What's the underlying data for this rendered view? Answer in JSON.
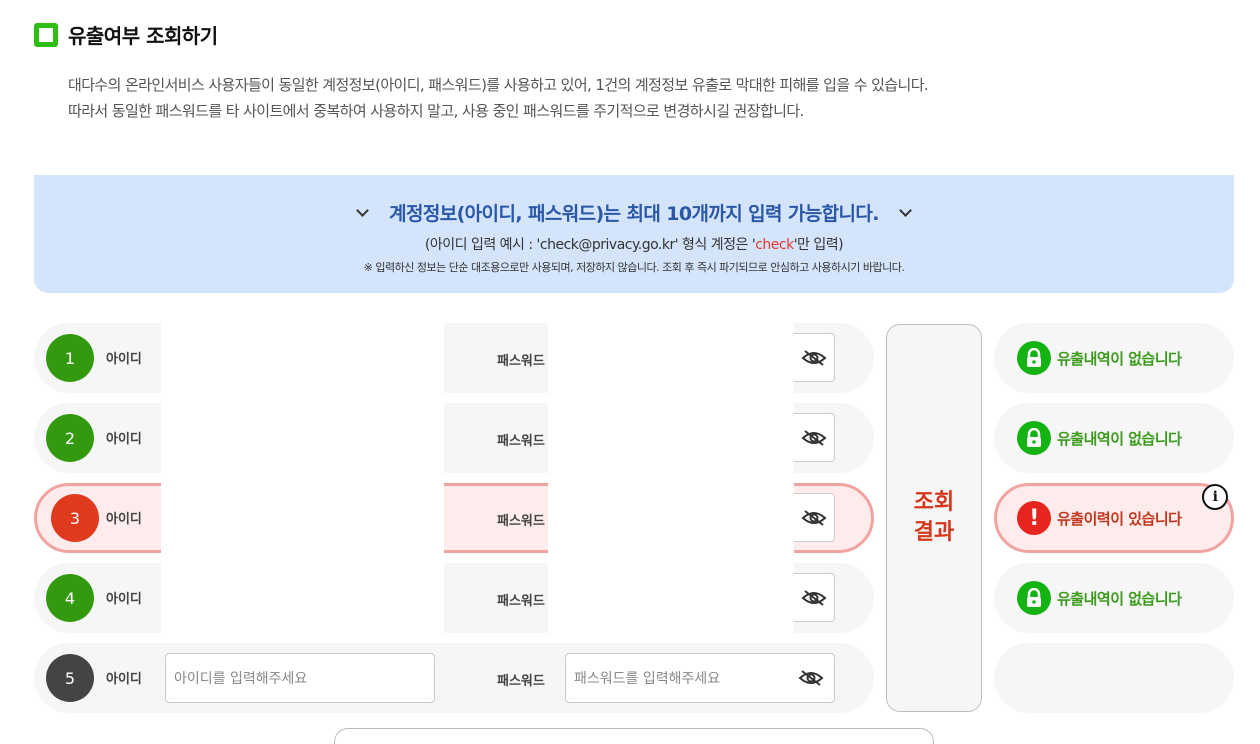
{
  "section": {
    "title": "유출여부 조회하기"
  },
  "description": {
    "line1": "대다수의 온라인서비스 사용자들이 동일한 계정정보(아이디, 패스워드)를 사용하고 있어, 1건의 계정정보 유출로 막대한 피해를 입을 수 있습니다.",
    "line2": "따라서 동일한 패스워드를 타 사이트에서 중복하여 사용하지 말고, 사용 중인 패스워드를 주기적으로 변경하시길 권장합니다."
  },
  "banner": {
    "main": "계정정보(아이디, 패스워드)는 최대 10개까지 입력 가능합니다.",
    "sub_prefix": "(아이디 입력 예시 : 'check@privacy.go.kr' 형식 계정은 '",
    "sub_highlight": "check",
    "sub_suffix": "'만 입력)",
    "note": "※ 입력하신 정보는 단순 대조용으로만 사용되며, 저장하지 않습니다. 조회 후 즉시 파기되므로 안심하고 사용하시기 바랍니다."
  },
  "labels": {
    "id": "아이디",
    "password": "패스워드"
  },
  "rows": [
    {
      "number": "1"
    },
    {
      "number": "2"
    },
    {
      "number": "3"
    },
    {
      "number": "4"
    },
    {
      "number": "5",
      "id_placeholder": "아이디를 입력해주세요",
      "pw_placeholder": "패스워드를 입력해주세요"
    }
  ],
  "check_button": {
    "line1": "조회",
    "line2": "결과"
  },
  "results": [
    {
      "text": "유출내역이 없습니다",
      "status": "safe"
    },
    {
      "text": "유출내역이 없습니다",
      "status": "safe"
    },
    {
      "text": "유출이력이 있습니다",
      "status": "leaked"
    },
    {
      "text": "유출내역이 없습니다",
      "status": "safe"
    },
    {
      "text": "",
      "status": "empty"
    }
  ],
  "info_icon": {
    "text": "i"
  },
  "colors": {
    "accent_green": "#2ebd13",
    "alert_red": "#df3a1e",
    "banner_bg": "#d4e5fb",
    "banner_text": "#2a57a8"
  }
}
